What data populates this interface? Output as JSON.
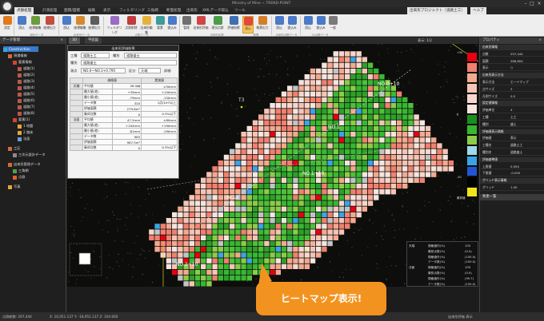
{
  "app": {
    "title": "Ministry of Mine ~ TREND-POINT",
    "window_controls": [
      "–",
      "□",
      "×"
    ]
  },
  "tabs": [
    {
      "label": "点群処理",
      "active": true
    },
    {
      "label": "計測処理",
      "active": false
    },
    {
      "label": "面積/図積",
      "active": false
    },
    {
      "label": "編集",
      "active": false
    },
    {
      "label": "表示",
      "active": false
    },
    {
      "label": "フィルタリング",
      "active": false
    },
    {
      "label": "三角網",
      "active": false
    },
    {
      "label": "断面処理",
      "active": false
    },
    {
      "label": "出来形",
      "active": false
    },
    {
      "label": "XMLデータ取込",
      "active": false
    },
    {
      "label": "ツール",
      "active": false
    }
  ],
  "tabs_right": [
    "出来形プロジェクト（道路土工）",
    "ヘルプ"
  ],
  "ribbon": {
    "buttons": [
      "設定",
      "読込",
      "座標編集",
      "座標出力",
      "読込",
      "座標編集",
      "座標出力",
      "フィルタリング",
      "点群削除",
      "出来形編集",
      "要素",
      "書込み",
      "管理",
      "出来形評価",
      "現況点群",
      "評価指標",
      "表示",
      "帳票出力",
      "読込",
      "書込み",
      "読込",
      "書込み",
      "一般"
    ],
    "groups": [
      "設計データ",
      "出来形データ",
      "点群データ",
      "出来形処理",
      "帳票",
      "出来形点群データ",
      "TS点群データ"
    ]
  },
  "left_panel": {
    "title": "データ管理",
    "items": [
      "Construction",
      "現場情報",
      "要素情報",
      "道路(1)",
      "道路(2)",
      "道路(3)",
      "道路(4)",
      "道路(5)",
      "道路(6)",
      "道路(7)",
      "道路(8)",
      "要素(1)",
      "1 地盤",
      "2 路床",
      "法面",
      "工区",
      "三次元設計データ",
      "出来形管理データ",
      "三角網",
      "点群",
      "写真"
    ]
  },
  "view_tabs": {
    "tabs": [
      "3D",
      "平面図"
    ],
    "tools_label": "表示: 1/2"
  },
  "dialog": {
    "title": "出来形評価結果",
    "fields": [
      {
        "label": "工種",
        "value": "道路土工",
        "label2": "種別",
        "value2": "道路盛土"
      },
      {
        "label": "種別",
        "value": "道路盛土"
      },
      {
        "label": "測点",
        "value": "NO.0～NO.3+0.795",
        "label2": "区分",
        "value2": "天端",
        "label3": "詳細"
      }
    ],
    "table": {
      "header": [
        "",
        "規格値",
        "",
        "実測値",
        ""
      ],
      "rows": [
        [
          "天端",
          "平均値",
          "-",
          "26.5㎜",
          "-",
          "±50mm"
        ],
        [
          "",
          "最大値(差)",
          "",
          "+39mm",
          "",
          "+150mm"
        ],
        [
          "",
          "最小値(差)",
          "",
          "-79mm",
          "",
          "-150mm"
        ],
        [
          "",
          "データ数",
          "",
          "320",
          "",
          "1点/1m²以上"
        ],
        [
          "",
          "評価面積",
          "",
          "279.6m²",
          "",
          ""
        ],
        [
          "",
          "棄却点数",
          "",
          "0",
          "",
          "0.3%以下"
        ],
        [
          "法面",
          "平均値",
          "",
          "47.2mm",
          "",
          "±80mm"
        ],
        [
          "",
          "最大値(差)",
          "",
          "+104mm",
          "",
          "+190mm"
        ],
        [
          "",
          "最小値(差)",
          "",
          "-81mm",
          "",
          "-190mm"
        ],
        [
          "",
          "データ数",
          "",
          "985",
          "",
          ""
        ],
        [
          "",
          "評価面積",
          "",
          "987.5m²",
          "",
          ""
        ],
        [
          "",
          "棄却点数",
          "",
          "0",
          "",
          "0.3%以下"
        ]
      ]
    }
  },
  "map": {
    "labels": [
      "NO.0+10",
      "NO.1",
      "NO.1+10",
      "NO.2",
      "NO.2+10"
    ],
    "survey_points": [
      "T3",
      "T4"
    ]
  },
  "legend": {
    "ticks": [
      "+50",
      "",
      "",
      "",
      "",
      "",
      "0",
      "",
      "",
      "",
      "",
      "",
      "-50",
      "",
      "棄却値"
    ],
    "colors": [
      "#e60012",
      "#f08070",
      "#f3a990",
      "#f6c4b6",
      "#f7d7cd",
      "#f5e5df",
      "#1a8f1e",
      "#37b832",
      "#8ccc4a",
      "#9fd9ea",
      "#3aa4e6",
      "#2255d4",
      "#000000",
      "#f2e41c"
    ]
  },
  "properties": {
    "title": "プロパティ",
    "rows": [
      {
        "section": true,
        "label": "出来形情報"
      },
      {
        "k": "点数",
        "v": "297,444"
      },
      {
        "k": "面積",
        "v": "268,804"
      },
      {
        "k": "表示",
        "v": "○"
      },
      {
        "section": true,
        "label": "出来形表示方法"
      },
      {
        "k": "表示方法",
        "v": "ヒートマップ"
      },
      {
        "k": "点サイズ",
        "v": "3"
      },
      {
        "k": "凡例サイズ",
        "v": "0.5"
      },
      {
        "section": true,
        "label": "設定値情報"
      },
      {
        "k": "評価単位",
        "v": "4"
      },
      {
        "k": "工種",
        "v": "土工"
      },
      {
        "k": "種別",
        "v": "盛土"
      },
      {
        "section": true,
        "label": "評価値表示情報"
      },
      {
        "k": "評価値",
        "v": "表示"
      },
      {
        "k": "工種名",
        "v": "道路土工"
      },
      {
        "k": "種別名",
        "v": "道路盛土"
      },
      {
        "section": true,
        "label": "評価基準値"
      },
      {
        "k": "上限値",
        "v": "0.050"
      },
      {
        "k": "下限値",
        "v": "-0.050"
      },
      {
        "section": true,
        "label": "グリッド表示情報"
      },
      {
        "k": "グリッド",
        "v": "1.00"
      }
    ],
    "lower_title": "要素一覧"
  },
  "summary": {
    "rows": [
      {
        "group": "天端",
        "k": "規格値内(%)",
        "v": "100"
      },
      {
        "group": "",
        "k": "棄却点数(%)",
        "v": "(0.0)"
      },
      {
        "group": "",
        "k": "規格値外(%)",
        "v": "(100.0)"
      },
      {
        "group": "",
        "k": "データ数(%)",
        "v": "(100.0)"
      },
      {
        "group": "法面",
        "k": "規格値内(%)",
        "v": "100"
      },
      {
        "group": "",
        "k": "棄却点数(%)",
        "v": "(0.0)"
      },
      {
        "group": "",
        "k": "規格値外(%)",
        "v": "(99.7)"
      },
      {
        "group": "",
        "k": "データ数(%)",
        "v": "(100.0)"
      }
    ]
  },
  "status": {
    "left": "点群総数: 297,444",
    "coords": "X: 10,051.137 Y: -18,951.137 Z: 104.660",
    "right": "出来形評価  表示"
  },
  "callout": {
    "text": "ヒートマップ表示!"
  }
}
